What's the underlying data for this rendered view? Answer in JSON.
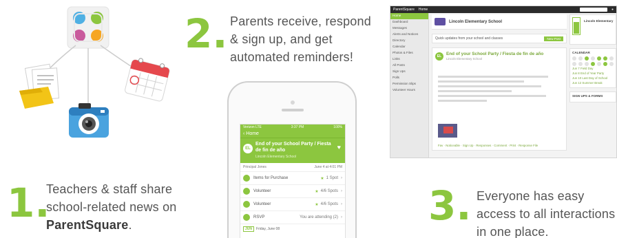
{
  "step1": {
    "number": "1",
    "dot": ".",
    "line1": "Teachers & staff share",
    "line2": "school-related news on",
    "brand": "ParentSquare",
    "end": "."
  },
  "step2": {
    "number": "2",
    "dot": ".",
    "line1": "Parents receive, respond",
    "line2": "& sign up, and get",
    "line3": "automated reminders!"
  },
  "step3": {
    "number": "3",
    "dot": ".",
    "line1": "Everyone has easy",
    "line2": "access to all interactions",
    "line3": "in one place."
  },
  "phone": {
    "carrier": "Verizon LTE",
    "time": "3:37 PM",
    "battery": "100%",
    "back_label": "Home",
    "post_badge": "EL",
    "post_title": "End of your School Party / Fiesta de fin de año",
    "post_school": "Lincoln Elementary School",
    "meta_left": "Principal Jones",
    "meta_right": "June 4 at 4:01 PM",
    "rows": [
      {
        "label": "Items for Purchase",
        "right": "1 Spot",
        "star": "★"
      },
      {
        "label": "Volunteer",
        "right": "4/6 Spots",
        "star": "★"
      },
      {
        "label": "Volunteer",
        "right": "4/6 Spots",
        "star": "★"
      },
      {
        "label": "RSVP",
        "right": "You are attending (2)",
        "star": ""
      }
    ],
    "date_box": "JUN",
    "date_text": "Friday, June 08"
  },
  "desktop": {
    "app_name": "ParentSquare",
    "home": "Home",
    "school_name": "Lincoln Elementary School",
    "new_post": "New Post",
    "update_prompt": "Quick updates from your school and classes",
    "post_badge": "EL",
    "post_title": "End of your School Party / Fiesta de fin de año",
    "post_sub": "Lincoln Elementary School",
    "links": "Fav · Noticeable · Sign Up · Responses · Comment · Print · Response File",
    "nav": [
      "Home",
      "Dashboard",
      "Messages",
      "Alerts and Notices",
      "Directory",
      "Calendar",
      "Photos & Files",
      "Links",
      "All Posts",
      "Sign Ups",
      "Polls",
      "Permission Slips",
      "Volunteer Hours"
    ],
    "right_cards": {
      "volunteer_title": "Lincoln Elementary",
      "calendar_title": "CALENDAR",
      "signups_title": "SIGN UPS & FORMS",
      "upcoming": [
        "Jun 7 Field Day",
        "Jun 8 End of Year Party",
        "Jun 10 Last Day of School",
        "Jun 12 Summer Break"
      ]
    }
  },
  "colors": {
    "accent": "#8cc63f",
    "text": "#555555"
  }
}
